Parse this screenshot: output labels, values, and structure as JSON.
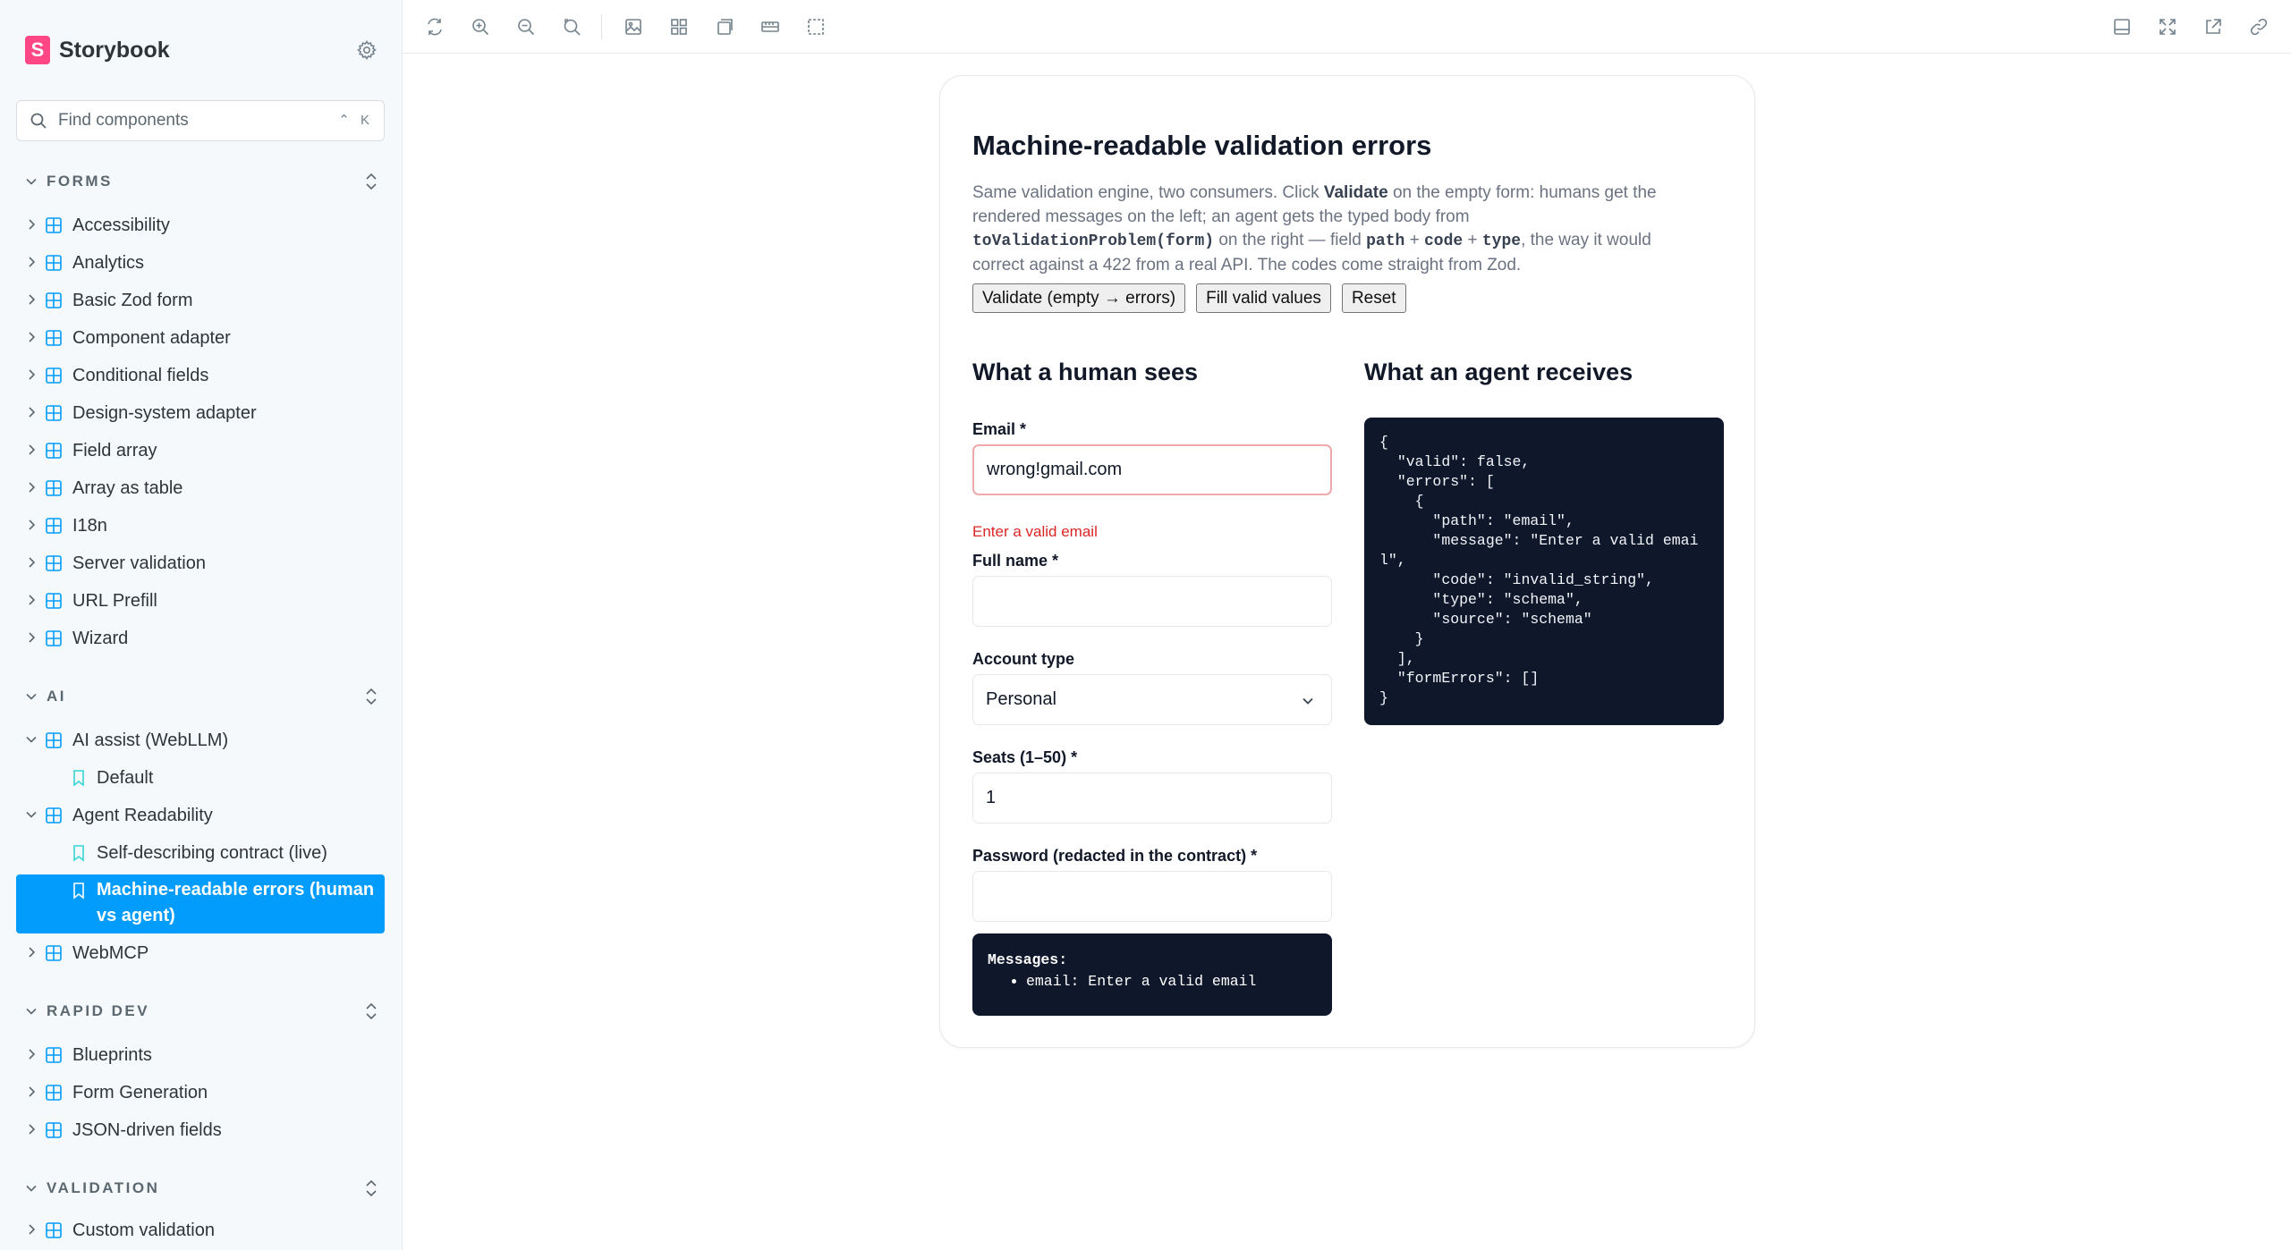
{
  "sidebar": {
    "brand": "Storybook",
    "search_placeholder": "Find components",
    "search_shortcut": "⌃ K",
    "groups": [
      {
        "title": "FORMS",
        "items": [
          {
            "label": "Accessibility"
          },
          {
            "label": "Analytics"
          },
          {
            "label": "Basic Zod form"
          },
          {
            "label": "Component adapter"
          },
          {
            "label": "Conditional fields"
          },
          {
            "label": "Design-system adapter"
          },
          {
            "label": "Field array"
          },
          {
            "label": "Array as table"
          },
          {
            "label": "I18n"
          },
          {
            "label": "Server validation"
          },
          {
            "label": "URL Prefill"
          },
          {
            "label": "Wizard"
          }
        ]
      },
      {
        "title": "AI",
        "items": [
          {
            "label": "AI assist (WebLLM)"
          },
          {
            "label": "Default"
          },
          {
            "label": "Agent Readability"
          },
          {
            "label": "Self-describing contract (live)"
          },
          {
            "label": "Machine-readable errors (human vs agent)"
          },
          {
            "label": "WebMCP"
          }
        ]
      },
      {
        "title": "RAPID DEV",
        "items": [
          {
            "label": "Blueprints"
          },
          {
            "label": "Form Generation"
          },
          {
            "label": "JSON-driven fields"
          }
        ]
      },
      {
        "title": "VALIDATION",
        "items": [
          {
            "label": "Custom validation"
          }
        ]
      }
    ]
  },
  "story": {
    "title": "Machine-readable validation errors",
    "description": {
      "p1": "Same validation engine, two consumers. Click ",
      "b1": "Validate",
      "p2": " on the empty form: humans get the rendered messages on the left; an agent gets the typed body from ",
      "c1": "toValidationProblem(form)",
      "p3": " on the right — field ",
      "c2": "path",
      "p4": " + ",
      "c3": "code",
      "p5": " + ",
      "c4": "type",
      "p6": ", the way it would correct against a 422 from a real API. The codes come straight from Zod."
    },
    "buttons": {
      "validate": "Validate (empty → errors)",
      "fill": "Fill valid values",
      "reset": "Reset"
    },
    "human_heading": "What a human sees",
    "agent_heading": "What an agent receives",
    "fields": {
      "email_label": "Email *",
      "email_value": "wrong!gmail.com",
      "email_error": "Enter a valid email",
      "fullname_label": "Full name *",
      "fullname_value": "",
      "account_label": "Account type",
      "account_value": "Personal",
      "seats_label": "Seats (1–50) *",
      "seats_value": "1",
      "password_label": "Password (redacted in the contract) *",
      "password_value": ""
    },
    "messages_title": "Messages:",
    "messages": [
      "email: Enter a valid email"
    ],
    "agent_json": "{\n  \"valid\": false,\n  \"errors\": [\n    {\n      \"path\": \"email\",\n      \"message\": \"Enter a valid email\",\n      \"code\": \"invalid_string\",\n      \"type\": \"schema\",\n      \"source\": \"schema\"\n    }\n  ],\n  \"formErrors\": []\n}"
  },
  "colors": {
    "accent": "#029cfd",
    "brand": "#ff4785",
    "error": "#dc2626",
    "code_bg": "#0f172a"
  }
}
